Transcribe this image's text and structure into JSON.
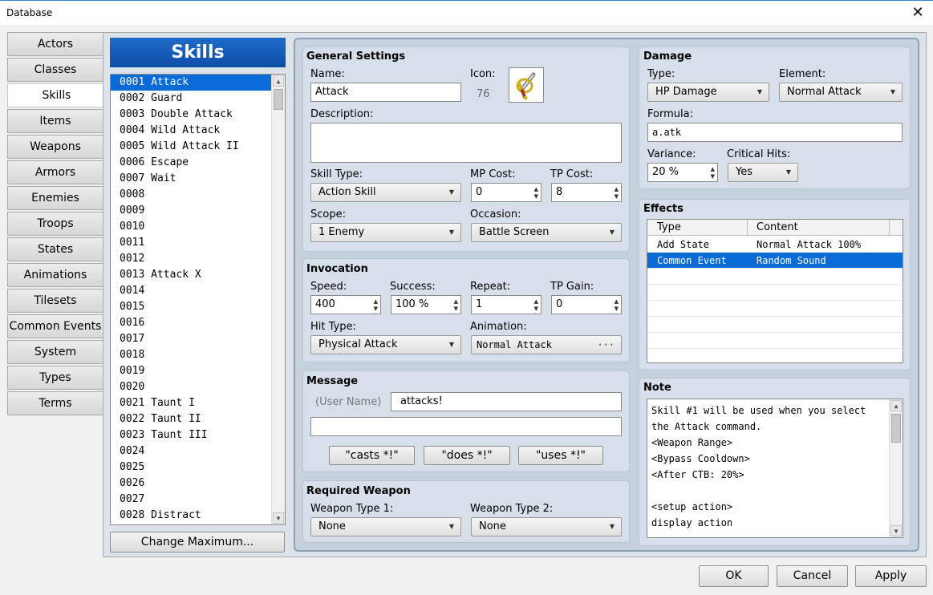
{
  "window": {
    "title": "Database",
    "close_glyph": "✕"
  },
  "tabs": [
    "Actors",
    "Classes",
    "Skills",
    "Items",
    "Weapons",
    "Armors",
    "Enemies",
    "Troops",
    "States",
    "Animations",
    "Tilesets",
    "Common Events",
    "System",
    "Types",
    "Terms"
  ],
  "selected_tab": "Skills",
  "list": {
    "header": "Skills",
    "items": [
      "0001 Attack",
      "0002 Guard",
      "0003 Double Attack",
      "0004 Wild Attack",
      "0005 Wild Attack II",
      "0006 Escape",
      "0007 Wait",
      "0008",
      "0009",
      "0010",
      "0011",
      "0012",
      "0013 Attack X",
      "0014",
      "0015",
      "0016",
      "0017",
      "0018",
      "0019",
      "0020",
      "0021 Taunt I",
      "0022 Taunt II",
      "0023 Taunt III",
      "0024",
      "0025",
      "0026",
      "0027",
      "0028 Distract"
    ],
    "selected_index": 0,
    "change_max_label": "Change Maximum..."
  },
  "general": {
    "title": "General Settings",
    "name_label": "Name:",
    "name_value": "Attack",
    "icon_label": "Icon:",
    "icon_index": "76",
    "icon_name": "sword-icon",
    "desc_label": "Description:",
    "desc_value": "",
    "skilltype_label": "Skill Type:",
    "skilltype_value": "Action Skill",
    "mpcost_label": "MP Cost:",
    "mpcost_value": "0",
    "tpcost_label": "TP Cost:",
    "tpcost_value": "8",
    "scope_label": "Scope:",
    "scope_value": "1 Enemy",
    "occasion_label": "Occasion:",
    "occasion_value": "Battle Screen"
  },
  "invocation": {
    "title": "Invocation",
    "speed_label": "Speed:",
    "speed_value": "400",
    "success_label": "Success:",
    "success_value": "100 %",
    "repeat_label": "Repeat:",
    "repeat_value": "1",
    "tpgain_label": "TP Gain:",
    "tpgain_value": "0",
    "hittype_label": "Hit Type:",
    "hittype_value": "Physical Attack",
    "animation_label": "Animation:",
    "animation_value": "Normal Attack",
    "animation_btn": "···"
  },
  "message": {
    "title": "Message",
    "username": "(User Name)",
    "line1": "attacks!",
    "line2": "",
    "btn_casts": "\"casts *!\"",
    "btn_does": "\"does *!\"",
    "btn_uses": "\"uses *!\""
  },
  "weapon": {
    "title": "Required Weapon",
    "type1_label": "Weapon Type 1:",
    "type1_value": "None",
    "type2_label": "Weapon Type 2:",
    "type2_value": "None"
  },
  "damage": {
    "title": "Damage",
    "type_label": "Type:",
    "type_value": "HP Damage",
    "element_label": "Element:",
    "element_value": "Normal Attack",
    "formula_label": "Formula:",
    "formula_value": "a.atk",
    "variance_label": "Variance:",
    "variance_value": "20 %",
    "critical_label": "Critical Hits:",
    "critical_value": "Yes"
  },
  "effects": {
    "title": "Effects",
    "col_type": "Type",
    "col_content": "Content",
    "rows": [
      {
        "type": "Add State",
        "content": "Normal Attack 100%"
      },
      {
        "type": "Common Event",
        "content": "Random Sound"
      }
    ],
    "selected_index": 1
  },
  "note": {
    "title": "Note",
    "lines": [
      "Skill #1 will be used when you select",
      "the Attack command.",
      "<Weapon Range>",
      "<Bypass Cooldown>",
      "<After CTB: 20%>",
      "",
      "<setup action>",
      "display action"
    ]
  },
  "footer": {
    "ok": "OK",
    "cancel": "Cancel",
    "apply": "Apply"
  },
  "colors": {
    "selection": "#0a6bd6",
    "header": "#0d4ea8"
  }
}
